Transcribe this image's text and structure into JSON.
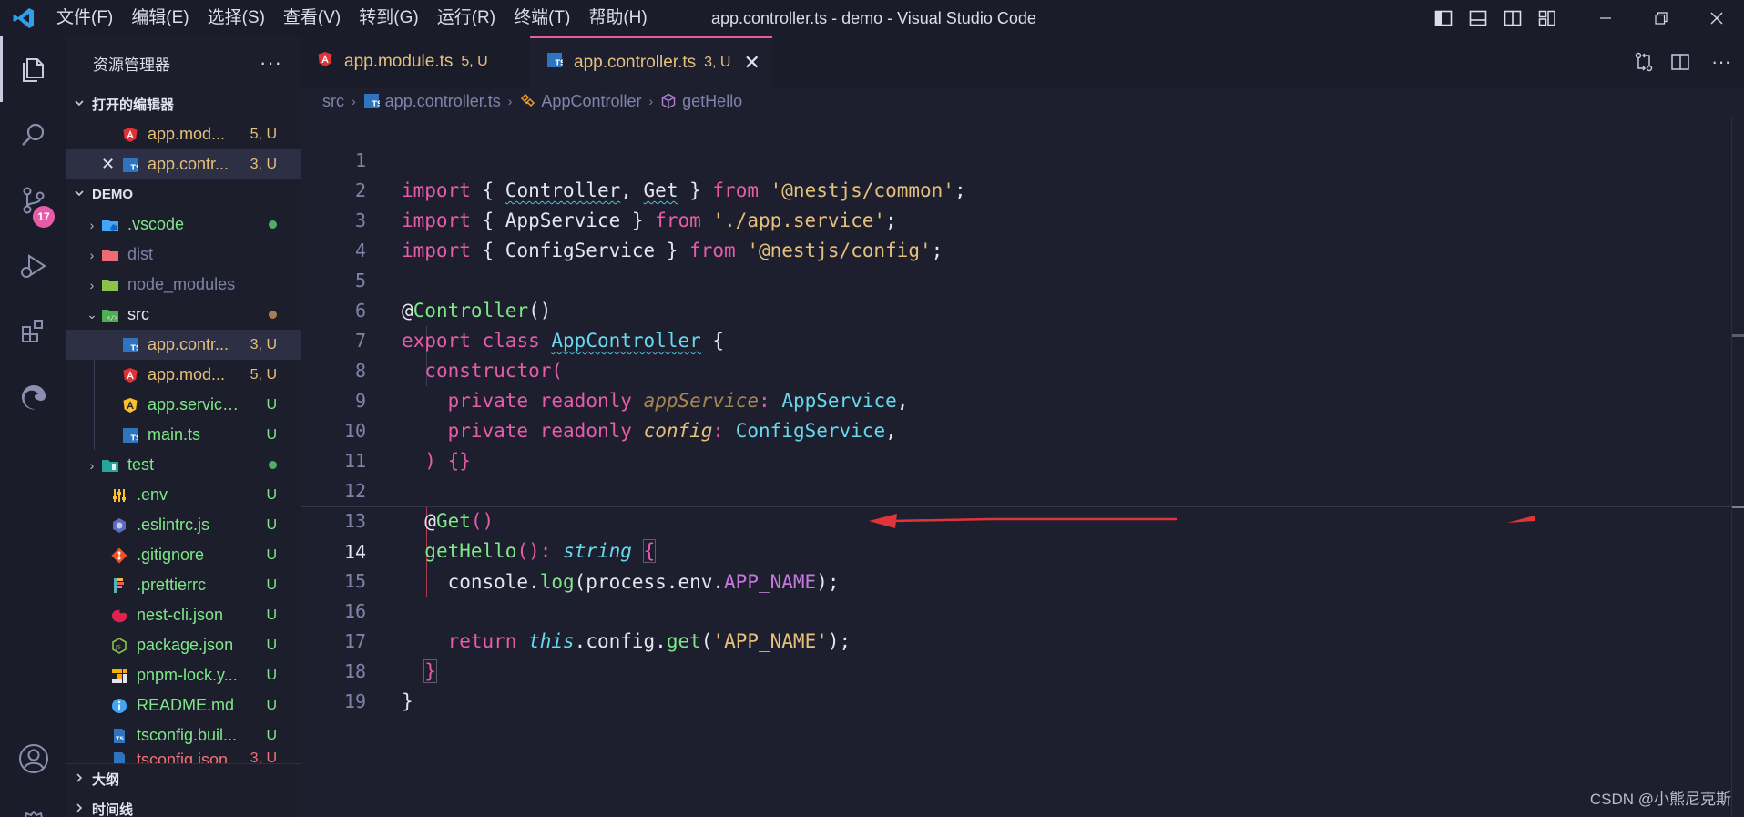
{
  "window": {
    "title": "app.controller.ts - demo - Visual Studio Code",
    "menu": [
      "文件(F)",
      "编辑(E)",
      "选择(S)",
      "查看(V)",
      "转到(G)",
      "运行(R)",
      "终端(T)",
      "帮助(H)"
    ]
  },
  "activity": {
    "scm_badge": "17"
  },
  "sidebar": {
    "title": "资源管理器",
    "open_editors_label": "打开的编辑器",
    "open_editors": [
      {
        "name": "app.mod...",
        "status": "5, U"
      },
      {
        "name": "app.contr...",
        "status": "3, U",
        "close": "✕"
      }
    ],
    "project_label": "DEMO",
    "tree": [
      {
        "name": ".vscode",
        "status": ""
      },
      {
        "name": "dist",
        "status": ""
      },
      {
        "name": "node_modules",
        "status": ""
      },
      {
        "name": "src",
        "status": ""
      },
      {
        "name": "app.contr...",
        "status": "3, U"
      },
      {
        "name": "app.mod...",
        "status": "5, U"
      },
      {
        "name": "app.service.ts",
        "status": "U"
      },
      {
        "name": "main.ts",
        "status": "U"
      },
      {
        "name": "test",
        "status": ""
      },
      {
        "name": ".env",
        "status": "U"
      },
      {
        "name": ".eslintrc.js",
        "status": "U"
      },
      {
        "name": ".gitignore",
        "status": "U"
      },
      {
        "name": ".prettierrc",
        "status": "U"
      },
      {
        "name": "nest-cli.json",
        "status": "U"
      },
      {
        "name": "package.json",
        "status": "U"
      },
      {
        "name": "pnpm-lock.y...",
        "status": "U"
      },
      {
        "name": "README.md",
        "status": "U"
      },
      {
        "name": "tsconfig.buil...",
        "status": "U"
      },
      {
        "name": "tsconfig.json",
        "status": "3, U"
      }
    ],
    "outline_label": "大纲",
    "timeline_label": "时间线"
  },
  "tabs": [
    {
      "label": "app.module.ts",
      "status": "5, U",
      "active": false
    },
    {
      "label": "app.controller.ts",
      "status": "3, U",
      "active": true,
      "close": "✕"
    }
  ],
  "breadcrumb": [
    "src",
    "app.controller.ts",
    "AppController",
    "getHello"
  ],
  "editor": {
    "current_line": 14,
    "lines": [
      "import { Controller, Get } from '@nestjs/common';",
      "import { AppService } from './app.service';",
      "import { ConfigService } from '@nestjs/config';",
      "",
      "@Controller()",
      "export class AppController {",
      "  constructor(",
      "    private readonly appService: AppService,",
      "    private readonly config: ConfigService,",
      "  ) {}",
      "",
      "  @Get()",
      "  getHello(): string {",
      "    console.log(process.env.APP_NAME);",
      "",
      "    return this.config.get('APP_NAME');",
      "  }",
      "}",
      ""
    ]
  },
  "watermark": "CSDN @小熊尼克斯",
  "colors": {
    "keyword": "#e75ca9",
    "string": "#e5c07b",
    "function": "#7ee787",
    "type": "#66d9ef",
    "annotation_arrow": "#e0343c"
  }
}
